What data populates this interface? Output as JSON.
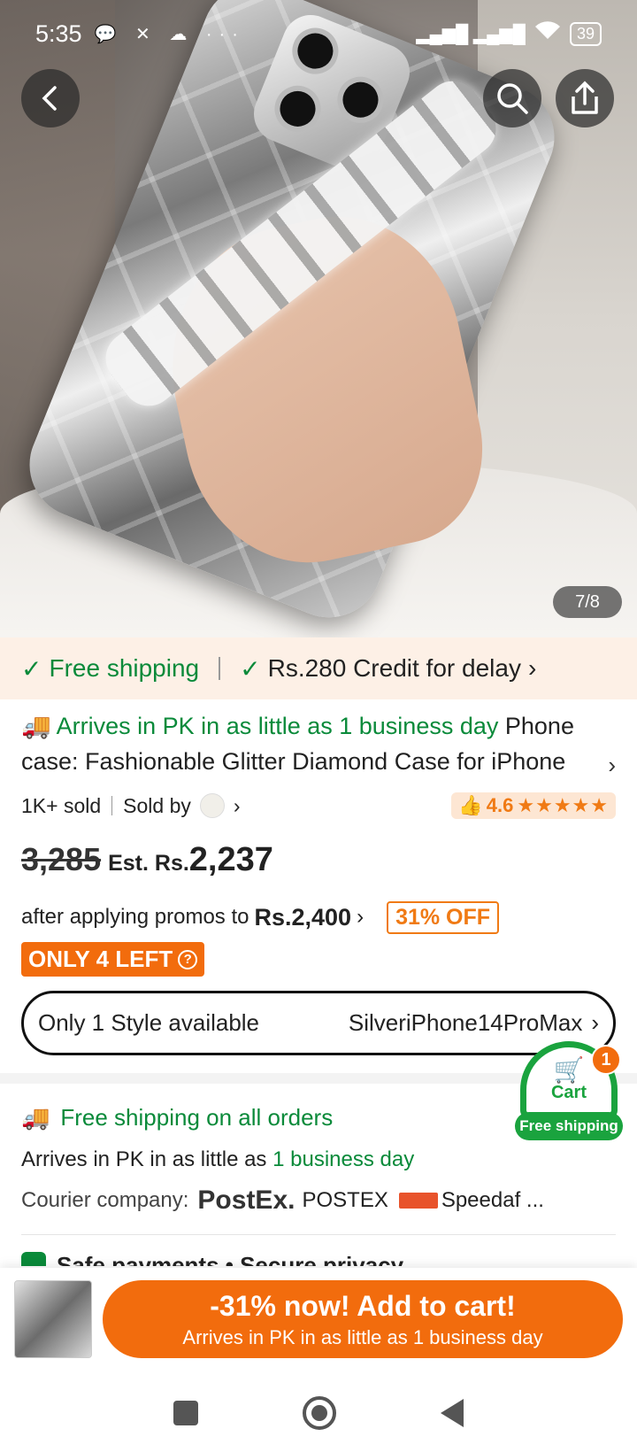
{
  "status_bar": {
    "time": "5:35",
    "notification_icons": "💬 ✕ ☁ ···",
    "signal": "▂▄▆█ ▂▄▆█",
    "wifi": "📶",
    "battery": "39"
  },
  "hero": {
    "image_counter": "7/8"
  },
  "shipping_strip": {
    "free_shipping": "Free shipping",
    "credit": "Rs.280 Credit for delay"
  },
  "product": {
    "arrival_badge": "Arrives in PK in as little as 1 business day",
    "title": "Phone case: Fashionable Glitter Diamond Case for iPhone",
    "sold": "1K+ sold",
    "sold_by": "Sold by",
    "rating": "4.6",
    "stars": "★★★★★",
    "old_price": "3,285",
    "est_label": "Est. Rs.",
    "new_price": "2,237",
    "promo_text": "after applying promos to",
    "promo_amount": "Rs.2,400",
    "discount_badge": "31% OFF",
    "stock_badge": "ONLY 4 LEFT"
  },
  "style_selector": {
    "label": "Only 1 Style available",
    "value": "SilveriPhone14ProMax"
  },
  "shipping_section": {
    "heading": "Free shipping on all orders",
    "arrive_prefix": "Arrives in PK in as little as",
    "arrive_days": "1 business day",
    "courier_label": "Courier company:",
    "courier_1_logo": "PostEx.",
    "courier_1": "POSTEX",
    "courier_2": "Speedaf ...",
    "safe_payments": "Safe payments • Secure privacy"
  },
  "cart_float": {
    "label": "Cart",
    "count": "1",
    "shipping": "Free shipping"
  },
  "bottom_bar": {
    "button_main": "-31% now! Add to cart!",
    "button_sub": "Arrives in PK in as little as 1 business day"
  },
  "colors": {
    "accent": "#f26c0d",
    "green": "#0a8a3a"
  }
}
